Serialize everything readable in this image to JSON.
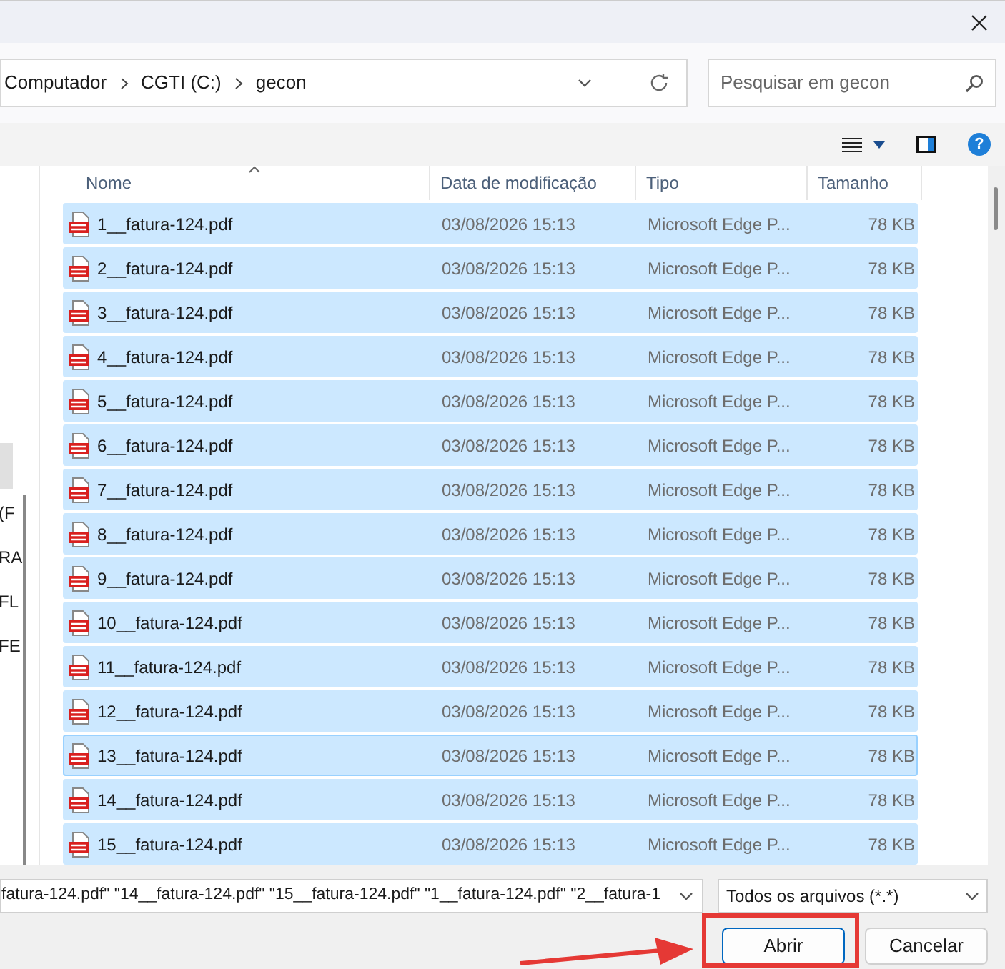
{
  "breadcrumbs": [
    "Computador",
    "CGTI (C:)",
    "gecon"
  ],
  "search": {
    "placeholder": "Pesquisar em gecon"
  },
  "nav_items": [
    "(F",
    "RA",
    "FL",
    "FE"
  ],
  "columns": [
    "Nome",
    "Data de modificação",
    "Tipo",
    "Tamanho"
  ],
  "files": [
    {
      "name": "1__fatura-124.pdf",
      "date": "03/08/2026 15:13",
      "type": "Microsoft Edge P...",
      "size": "78 KB",
      "selected": true,
      "focused": false
    },
    {
      "name": "2__fatura-124.pdf",
      "date": "03/08/2026 15:13",
      "type": "Microsoft Edge P...",
      "size": "78 KB",
      "selected": true,
      "focused": false
    },
    {
      "name": "3__fatura-124.pdf",
      "date": "03/08/2026 15:13",
      "type": "Microsoft Edge P...",
      "size": "78 KB",
      "selected": true,
      "focused": false
    },
    {
      "name": "4__fatura-124.pdf",
      "date": "03/08/2026 15:13",
      "type": "Microsoft Edge P...",
      "size": "78 KB",
      "selected": true,
      "focused": false
    },
    {
      "name": "5__fatura-124.pdf",
      "date": "03/08/2026 15:13",
      "type": "Microsoft Edge P...",
      "size": "78 KB",
      "selected": true,
      "focused": false
    },
    {
      "name": "6__fatura-124.pdf",
      "date": "03/08/2026 15:13",
      "type": "Microsoft Edge P...",
      "size": "78 KB",
      "selected": true,
      "focused": false
    },
    {
      "name": "7__fatura-124.pdf",
      "date": "03/08/2026 15:13",
      "type": "Microsoft Edge P...",
      "size": "78 KB",
      "selected": true,
      "focused": false
    },
    {
      "name": "8__fatura-124.pdf",
      "date": "03/08/2026 15:13",
      "type": "Microsoft Edge P...",
      "size": "78 KB",
      "selected": true,
      "focused": false
    },
    {
      "name": "9__fatura-124.pdf",
      "date": "03/08/2026 15:13",
      "type": "Microsoft Edge P...",
      "size": "78 KB",
      "selected": true,
      "focused": false
    },
    {
      "name": "10__fatura-124.pdf",
      "date": "03/08/2026 15:13",
      "type": "Microsoft Edge P...",
      "size": "78 KB",
      "selected": true,
      "focused": false
    },
    {
      "name": "11__fatura-124.pdf",
      "date": "03/08/2026 15:13",
      "type": "Microsoft Edge P...",
      "size": "78 KB",
      "selected": true,
      "focused": false
    },
    {
      "name": "12__fatura-124.pdf",
      "date": "03/08/2026 15:13",
      "type": "Microsoft Edge P...",
      "size": "78 KB",
      "selected": true,
      "focused": false
    },
    {
      "name": "13__fatura-124.pdf",
      "date": "03/08/2026 15:13",
      "type": "Microsoft Edge P...",
      "size": "78 KB",
      "selected": true,
      "focused": true
    },
    {
      "name": "14__fatura-124.pdf",
      "date": "03/08/2026 15:13",
      "type": "Microsoft Edge P...",
      "size": "78 KB",
      "selected": true,
      "focused": false
    },
    {
      "name": "15__fatura-124.pdf",
      "date": "03/08/2026 15:13",
      "type": "Microsoft Edge P...",
      "size": "78 KB",
      "selected": true,
      "focused": false
    }
  ],
  "filename": {
    "value": "fatura-124.pdf\" \"14__fatura-124.pdf\" \"15__fatura-124.pdf\" \"1__fatura-124.pdf\" \"2__fatura-1"
  },
  "filter": {
    "value": "Todos os arquivos (*.*)"
  },
  "buttons": [
    "Abrir",
    "Cancelar"
  ],
  "help": {
    "glyph": "?"
  }
}
